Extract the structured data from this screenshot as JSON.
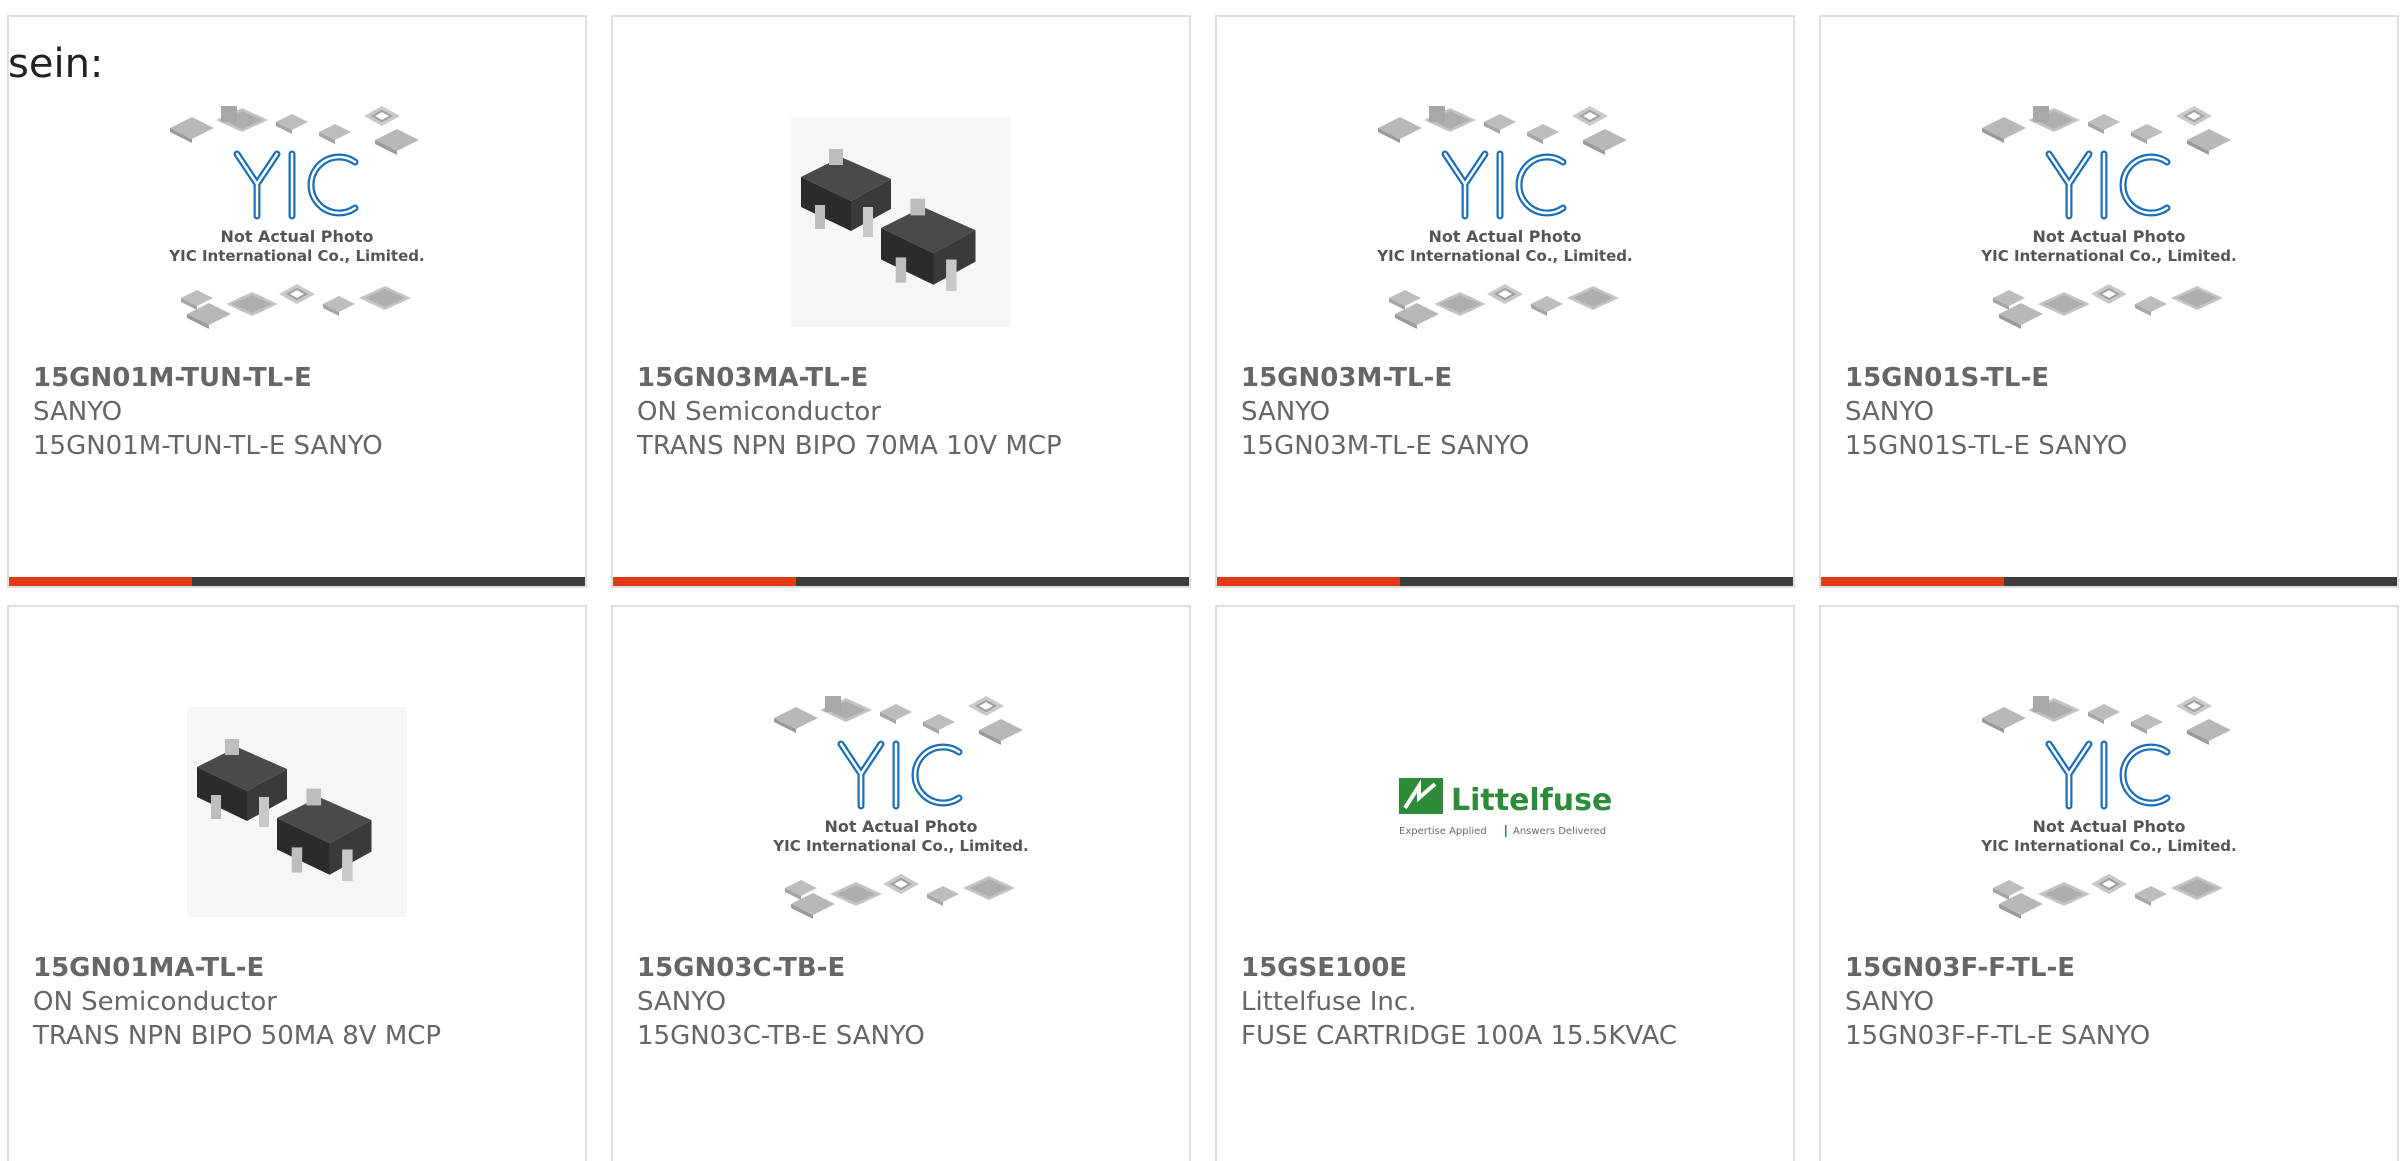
{
  "intro_text": "sein:",
  "placeholder": {
    "line1": "Not Actual Photo",
    "line2": "YIC International Co., Limited."
  },
  "littelfuse_logo": {
    "name": "Littelfuse",
    "tagline_left": "Expertise Applied",
    "tagline_right": "Answers Delivered"
  },
  "products": [
    {
      "part": "15GN01M-TUN-TL-E",
      "manufacturer": "SANYO",
      "description": "15GN01M-TUN-TL-E SANYO",
      "image": "yic-placeholder"
    },
    {
      "part": "15GN03MA-TL-E",
      "manufacturer": "ON Semiconductor",
      "description": "TRANS NPN BIPO 70MA 10V MCP",
      "image": "transistor-photo"
    },
    {
      "part": "15GN03M-TL-E",
      "manufacturer": "SANYO",
      "description": "15GN03M-TL-E SANYO",
      "image": "yic-placeholder"
    },
    {
      "part": "15GN01S-TL-E",
      "manufacturer": "SANYO",
      "description": "15GN01S-TL-E SANYO",
      "image": "yic-placeholder"
    },
    {
      "part": "15GN01MA-TL-E",
      "manufacturer": "ON Semiconductor",
      "description": "TRANS NPN BIPO 50MA 8V MCP",
      "image": "transistor-photo"
    },
    {
      "part": "15GN03C-TB-E",
      "manufacturer": "SANYO",
      "description": "15GN03C-TB-E SANYO",
      "image": "yic-placeholder"
    },
    {
      "part": "15GSE100E",
      "manufacturer": "Littelfuse Inc.",
      "description": "FUSE CARTRIDGE 100A 15.5KVAC",
      "image": "littelfuse-logo"
    },
    {
      "part": "15GN03F-F-TL-E",
      "manufacturer": "SANYO",
      "description": "15GN03F-F-TL-E SANYO",
      "image": "yic-placeholder"
    }
  ],
  "colors": {
    "accent": "#e03a16",
    "bar": "#3d3d3d",
    "text": "#666666",
    "border": "#dedede",
    "yic_blue": "#1d6fb8",
    "littelfuse_green": "#2e8b3a"
  }
}
